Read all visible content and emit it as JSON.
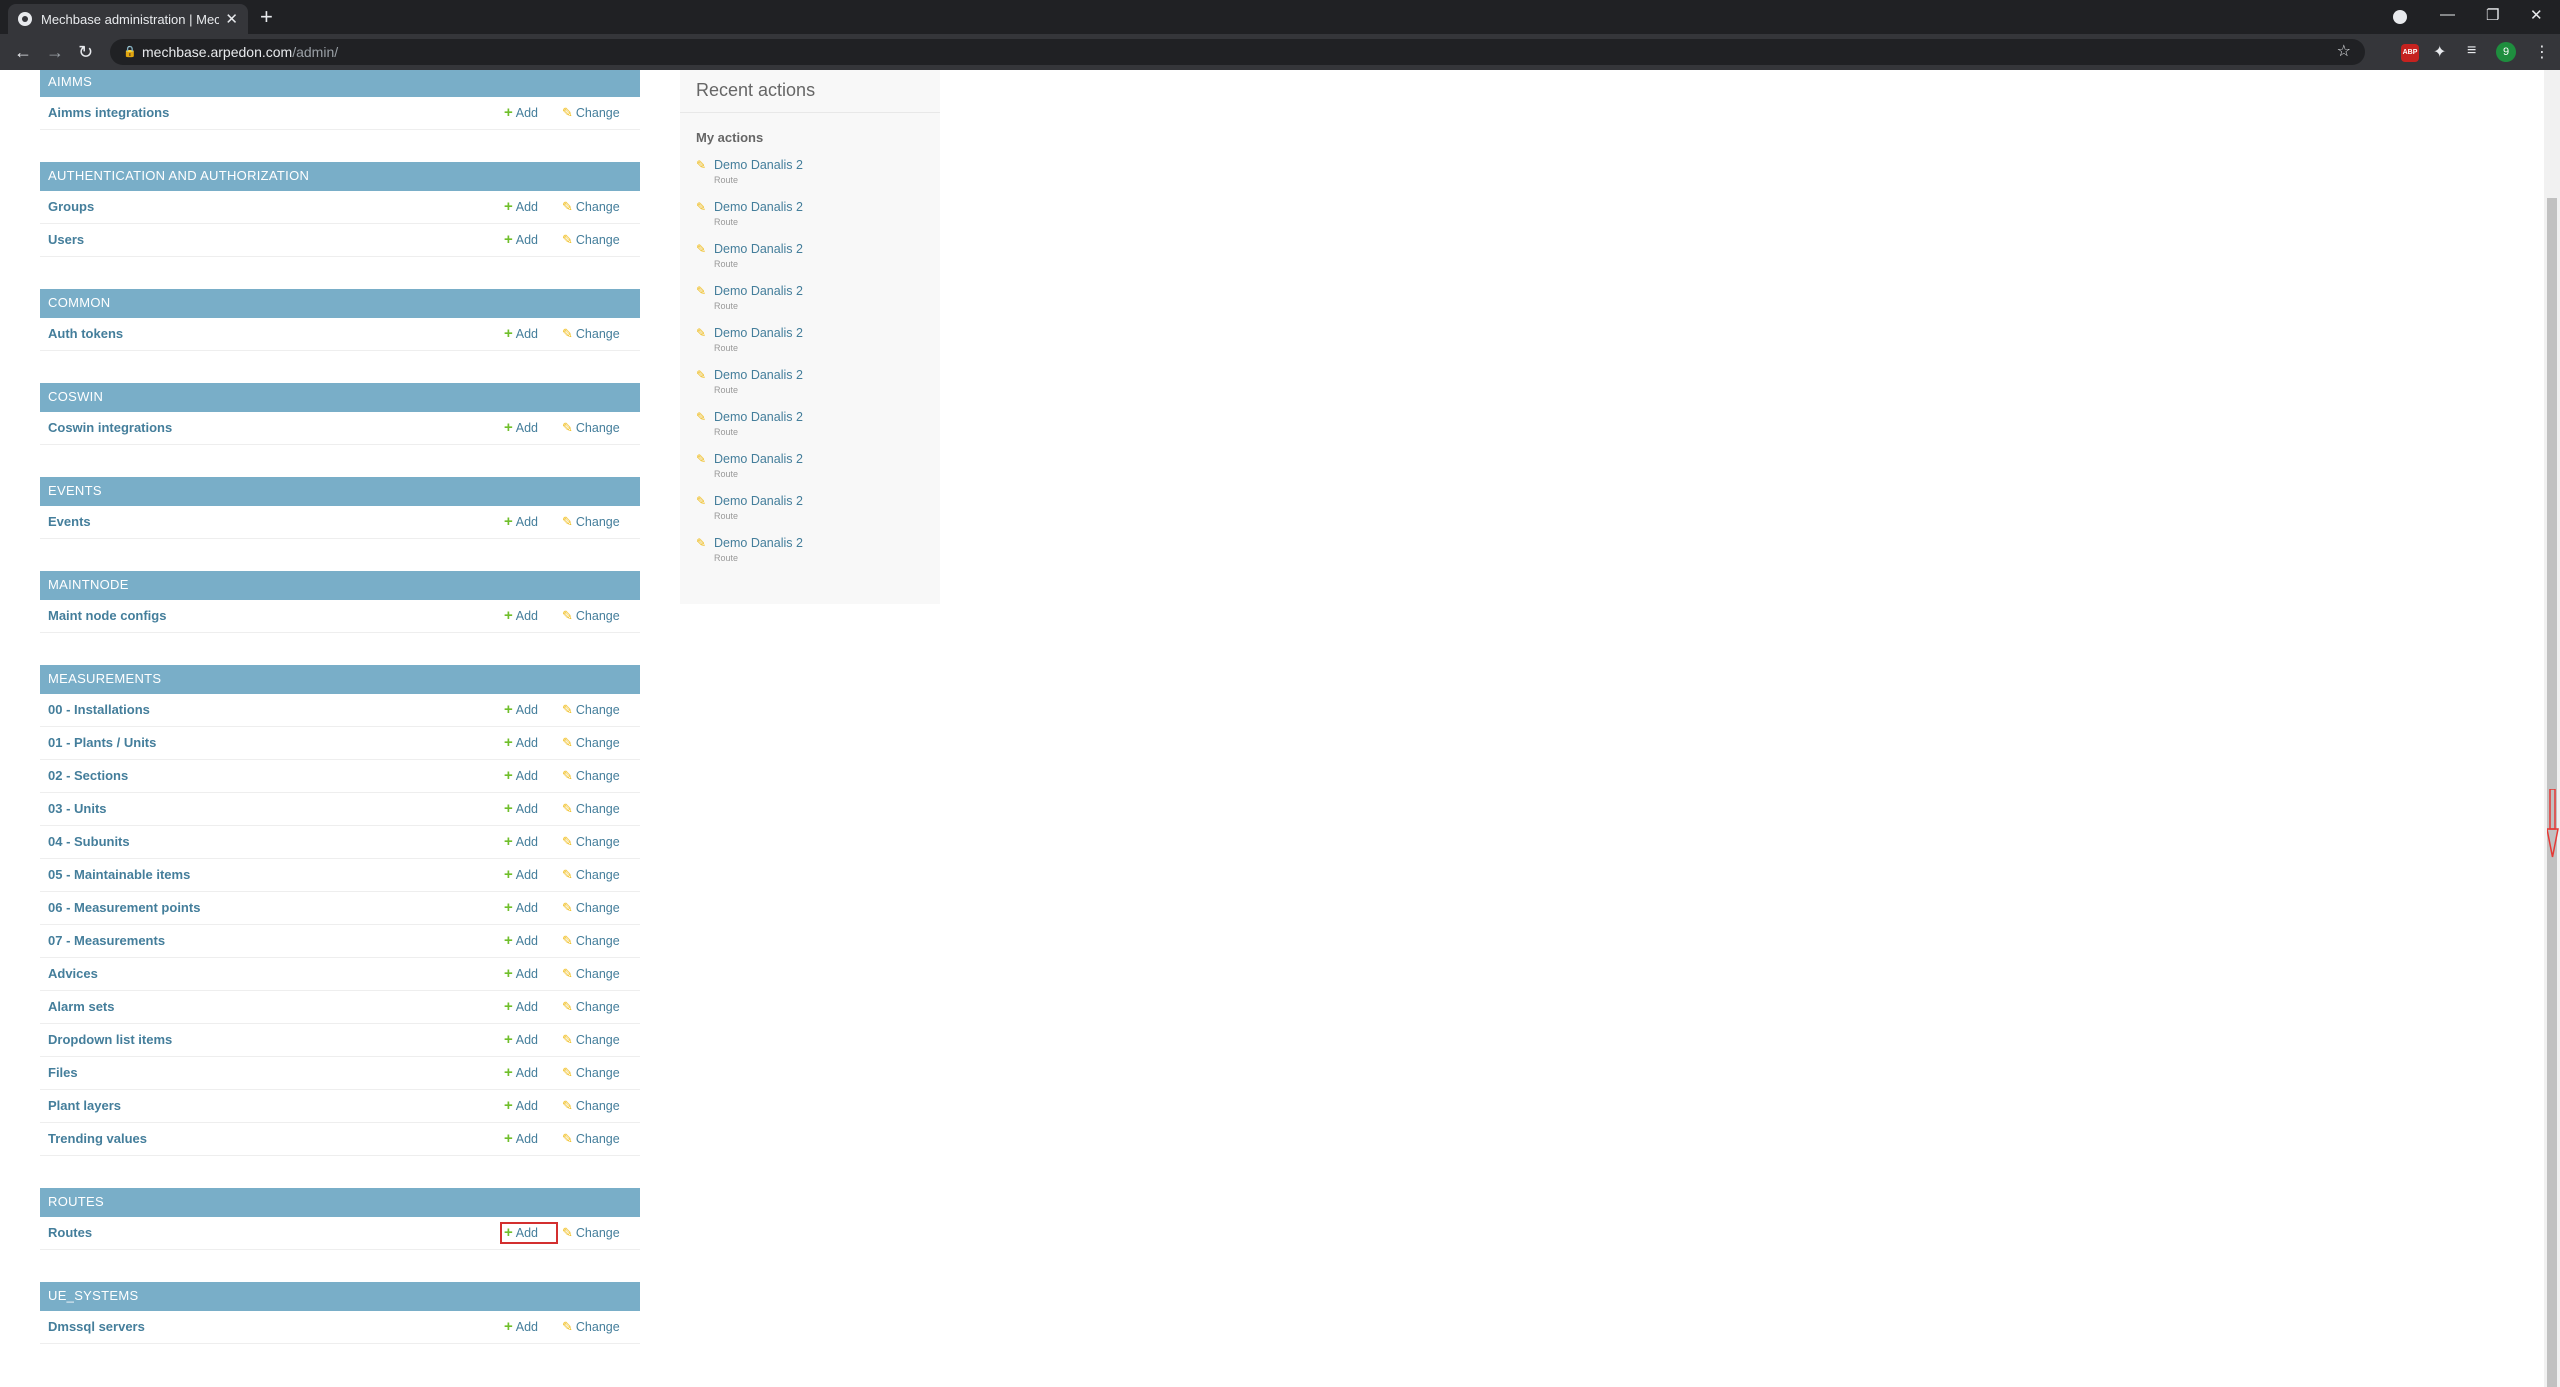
{
  "browser": {
    "tab_title": "Mechbase administration | Mech",
    "url_host": "mechbase.arpedon.com",
    "url_path": "/admin/",
    "avatar_letter": "9",
    "ext_abp_label": "ABP"
  },
  "modules": [
    {
      "caption": "AIMMS",
      "models": [
        {
          "name": "Aimms integrations"
        }
      ]
    },
    {
      "caption": "AUTHENTICATION AND AUTHORIZATION",
      "models": [
        {
          "name": "Groups"
        },
        {
          "name": "Users"
        }
      ]
    },
    {
      "caption": "COMMON",
      "models": [
        {
          "name": "Auth tokens"
        }
      ]
    },
    {
      "caption": "COSWIN",
      "models": [
        {
          "name": "Coswin integrations"
        }
      ]
    },
    {
      "caption": "EVENTS",
      "models": [
        {
          "name": "Events"
        }
      ]
    },
    {
      "caption": "MAINTNODE",
      "models": [
        {
          "name": "Maint node configs"
        }
      ]
    },
    {
      "caption": "MEASUREMENTS",
      "models": [
        {
          "name": "00 - Installations"
        },
        {
          "name": "01 - Plants / Units"
        },
        {
          "name": "02 - Sections"
        },
        {
          "name": "03 - Units"
        },
        {
          "name": "04 - Subunits"
        },
        {
          "name": "05 - Maintainable items"
        },
        {
          "name": "06 - Measurement points"
        },
        {
          "name": "07 - Measurements"
        },
        {
          "name": "Advices"
        },
        {
          "name": "Alarm sets"
        },
        {
          "name": "Dropdown list items"
        },
        {
          "name": "Files"
        },
        {
          "name": "Plant layers"
        },
        {
          "name": "Trending values"
        }
      ]
    },
    {
      "caption": "ROUTES",
      "models": [
        {
          "name": "Routes",
          "highlight_add": true
        }
      ]
    },
    {
      "caption": "UE_SYSTEMS",
      "models": [
        {
          "name": "Dmssql servers"
        }
      ]
    }
  ],
  "labels": {
    "add": "Add",
    "change": "Change"
  },
  "recent_actions": {
    "title": "Recent actions",
    "subtitle": "My actions",
    "items": [
      {
        "label": "Demo Danalis 2",
        "type": "Route"
      },
      {
        "label": "Demo Danalis 2",
        "type": "Route"
      },
      {
        "label": "Demo Danalis 2",
        "type": "Route"
      },
      {
        "label": "Demo Danalis 2",
        "type": "Route"
      },
      {
        "label": "Demo Danalis 2",
        "type": "Route"
      },
      {
        "label": "Demo Danalis 2",
        "type": "Route"
      },
      {
        "label": "Demo Danalis 2",
        "type": "Route"
      },
      {
        "label": "Demo Danalis 2",
        "type": "Route"
      },
      {
        "label": "Demo Danalis 2",
        "type": "Route"
      },
      {
        "label": "Demo Danalis 2",
        "type": "Route"
      }
    ]
  },
  "colors": {
    "module_header": "#79aec8",
    "link": "#447e9b",
    "add_icon": "#70bf2b",
    "change_icon": "#efb80b",
    "highlight_border": "#d32f2f"
  }
}
